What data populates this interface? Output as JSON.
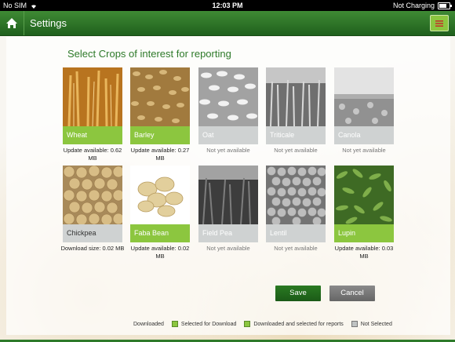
{
  "status_bar": {
    "carrier": "No SIM",
    "time": "12:03 PM",
    "charging": "Not Charging"
  },
  "nav": {
    "title": "Settings"
  },
  "page": {
    "section_title": "Select Crops of interest for reporting"
  },
  "crops": [
    {
      "name": "Wheat",
      "status": "Update available: 0.62 MB",
      "selected": true
    },
    {
      "name": "Barley",
      "status": "Update available: 0.27 MB",
      "selected": true
    },
    {
      "name": "Oat",
      "status": "Not yet available",
      "selected": false
    },
    {
      "name": "Triticale",
      "status": "Not yet available",
      "selected": false
    },
    {
      "name": "Canola",
      "status": "Not yet available",
      "selected": false
    },
    {
      "name": "Chickpea",
      "status": "Download size: 0.02 MB",
      "selected": false
    },
    {
      "name": "Faba Bean",
      "status": "Update available: 0.02 MB",
      "selected": true
    },
    {
      "name": "Field Pea",
      "status": "Not yet available",
      "selected": false
    },
    {
      "name": "Lentil",
      "status": "Not yet available",
      "selected": false
    },
    {
      "name": "Lupin",
      "status": "Update available: 0.03 MB",
      "selected": true
    }
  ],
  "buttons": {
    "save": "Save",
    "cancel": "Cancel"
  },
  "legend": {
    "downloaded": "Downloaded",
    "selected_for_download": "Selected for Download",
    "downloaded_and_selected": "Downloaded and selected for reports",
    "not_selected": "Not Selected"
  },
  "colors": {
    "nav_green": "#2e7a2a",
    "selected_green": "#8cc63f",
    "unselected_gray": "#cfd2d2",
    "cancel_gray": "#777777"
  }
}
